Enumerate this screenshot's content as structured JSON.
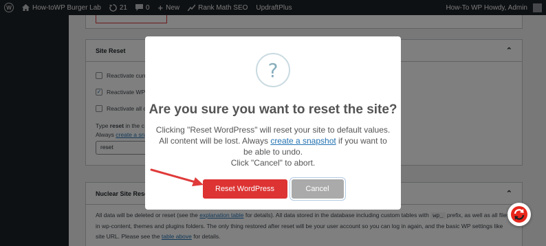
{
  "admin_bar": {
    "site_name": "How-toWP Burger Lab",
    "updates_count": "21",
    "comments_count": "0",
    "new_label": "New",
    "rank_math_label": "Rank Math SEO",
    "updraft_label": "UpdraftPlus",
    "howdy": "How-To WP Howdy, Admin"
  },
  "site_reset": {
    "title": "Site Reset",
    "options": [
      {
        "label": "Reactivate curr",
        "checked": false
      },
      {
        "label": "Reactivate WP",
        "checked": true
      },
      {
        "label": "Reactivate all c",
        "checked": false
      }
    ],
    "type_prefix": "Type ",
    "type_keyword": "reset",
    "type_suffix": " in the c",
    "always_prefix": "Always ",
    "always_link": "create a sn",
    "input_value": "reset"
  },
  "nuclear_reset": {
    "title": "Nuclear Site Reset",
    "text_1": "All data will be deleted or reset (see the ",
    "link_1": "explanation table",
    "text_2": " for details). All data stored in the database including custom tables with",
    "code": "wp_",
    "text_3": " prefix, as well as all files in wp-content, themes and plugins folders. The only thing restored after reset will be your user",
    "text_4": "account so you can log in again, and the basic WP settings like site URL. Please see the ",
    "link_2": "table above",
    "text_5": " for details."
  },
  "modal": {
    "icon": "?",
    "title": "Are you sure you want to reset the site?",
    "text_before": "Clicking \"Reset WordPress\" will reset your site to default values. All content will be lost. Always ",
    "link": "create a snapshot",
    "text_after": " if you want to be able to undo.",
    "text_cancel": "Click \"Cancel\" to abort.",
    "confirm_label": "Reset WordPress",
    "cancel_label": "Cancel"
  },
  "colors": {
    "admin_bar": "#1d2327",
    "confirm": "#dd3333",
    "cancel": "#aaaaaa",
    "link": "#2271b1",
    "annotation_arrow": "#e03a3a"
  }
}
